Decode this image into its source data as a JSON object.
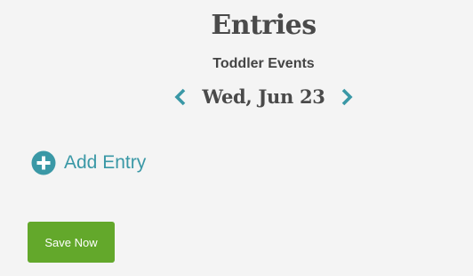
{
  "header": {
    "title": "Entries",
    "subtitle": "Toddler Events"
  },
  "date_nav": {
    "date": "Wed, Jun 23",
    "prev_icon": "chevron-left-icon",
    "next_icon": "chevron-right-icon"
  },
  "actions": {
    "add_entry_label": "Add Entry",
    "add_icon": "plus-circle-icon",
    "save_label": "Save Now"
  },
  "colors": {
    "accent": "#3a98a6",
    "save_button": "#63a82b",
    "background": "#f4f4f4",
    "heading": "#4a4a4a"
  }
}
